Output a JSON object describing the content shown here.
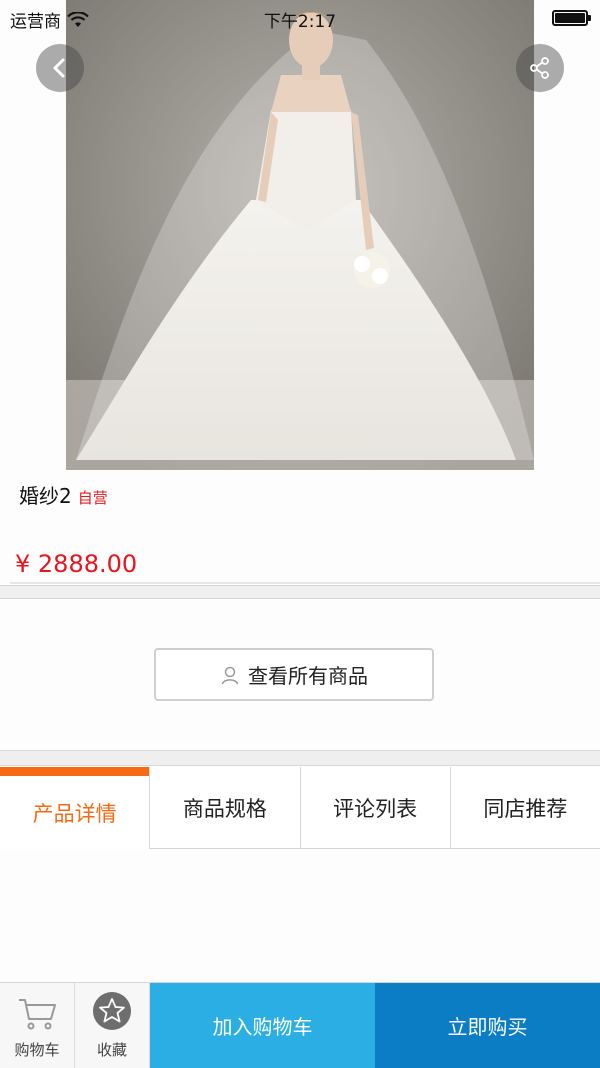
{
  "status_bar": {
    "carrier": "运营商",
    "time": "下午2:17"
  },
  "product": {
    "name": "婚纱2",
    "self_operated_tag": "自营",
    "price": "¥ 2888.00"
  },
  "view_all_button": {
    "label": "查看所有商品",
    "icon": "user-icon"
  },
  "tabs": [
    {
      "label": "产品详情",
      "active": true
    },
    {
      "label": "商品规格",
      "active": false
    },
    {
      "label": "评论列表",
      "active": false
    },
    {
      "label": "同店推荐",
      "active": false
    }
  ],
  "bottom_bar": {
    "cart_label": "购物车",
    "favorite_label": "收藏",
    "add_to_cart_label": "加入购物车",
    "buy_now_label": "立即购买"
  },
  "colors": {
    "accent_orange": "#f56a13",
    "price_red": "#e8151c",
    "add_to_cart_blue": "#2aaee4",
    "buy_now_blue": "#0a7dc5"
  }
}
